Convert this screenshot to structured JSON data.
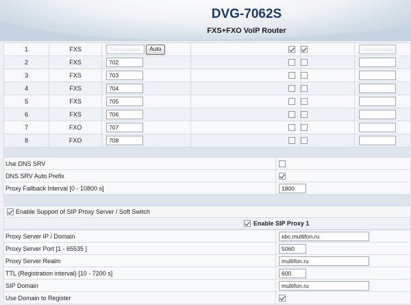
{
  "header": {
    "model": "DVG-7062S",
    "subtitle": "FXS+FXO VoIP Router"
  },
  "lines": [
    {
      "num": "1",
      "type": "FXS",
      "number": "7xxxxxxxxx",
      "auto_label": "Auto",
      "cb1": true,
      "cb2": true,
      "extra": "7xxxxxxxxx"
    },
    {
      "num": "2",
      "type": "FXS",
      "number": "702",
      "cb1": false,
      "cb2": false,
      "extra": ""
    },
    {
      "num": "3",
      "type": "FXS",
      "number": "703",
      "cb1": false,
      "cb2": false,
      "extra": ""
    },
    {
      "num": "4",
      "type": "FXS",
      "number": "704",
      "cb1": false,
      "cb2": false,
      "extra": ""
    },
    {
      "num": "5",
      "type": "FXS",
      "number": "705",
      "cb1": false,
      "cb2": false,
      "extra": ""
    },
    {
      "num": "6",
      "type": "FXS",
      "number": "706",
      "cb1": false,
      "cb2": false,
      "extra": ""
    },
    {
      "num": "7",
      "type": "FXO",
      "number": "707",
      "cb1": false,
      "cb2": false,
      "extra": ""
    },
    {
      "num": "8",
      "type": "FXO",
      "number": "708",
      "cb1": false,
      "cb2": false,
      "extra": ""
    }
  ],
  "dns": {
    "use_dns_srv_label": "Use DNS SRV",
    "use_dns_srv": false,
    "auto_prefix_label": "DNS SRV Auto Prefix",
    "auto_prefix": true,
    "fallback_label": "Proxy Fallback Interval [0 - 10800 s]",
    "fallback_value": "1800"
  },
  "proxy": {
    "enable_support_label": "Enable Support of SIP Proxy Server / Soft Switch",
    "enable_support": true,
    "enable_proxy1_label": "Enable SIP Proxy 1",
    "enable_proxy1": true,
    "server_label": "Proxy Server IP / Domain",
    "server_value": "sbc.multifon.ru",
    "port_label": "Proxy Server Port [1 - 65535 ]",
    "port_value": "5060",
    "realm_label": "Proxy Server Realm",
    "realm_value": "multifon.ru",
    "ttl_label": "TTL (Registration interval) [10 - 7200 s]",
    "ttl_value": "600",
    "domain_label": "SIP Domain",
    "domain_value": "multifon.ru",
    "use_domain_label": "Use Domain to Register",
    "use_domain": true
  }
}
